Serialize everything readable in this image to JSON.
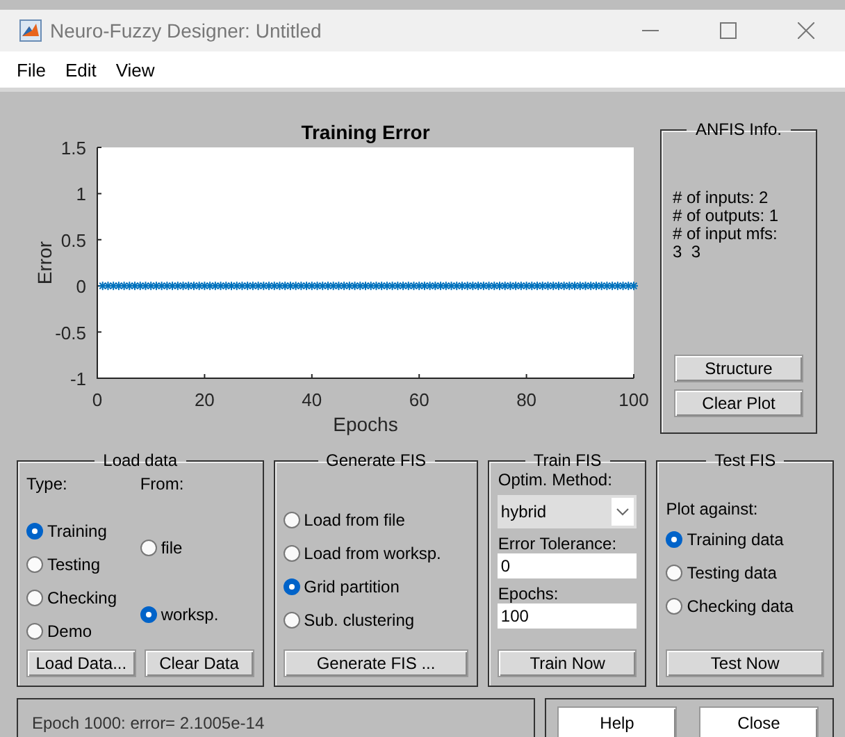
{
  "window": {
    "title": "Neuro-Fuzzy Designer: Untitled"
  },
  "menu": [
    "File",
    "Edit",
    "View"
  ],
  "plot": {
    "chart_data": {
      "type": "scatter",
      "title": "Training Error",
      "xlabel": "Epochs",
      "ylabel": "Error",
      "x": [
        1,
        2,
        3,
        4,
        5,
        6,
        7,
        8,
        9,
        10,
        11,
        12,
        13,
        14,
        15,
        16,
        17,
        18,
        19,
        20,
        21,
        22,
        23,
        24,
        25,
        26,
        27,
        28,
        29,
        30,
        31,
        32,
        33,
        34,
        35,
        36,
        37,
        38,
        39,
        40,
        41,
        42,
        43,
        44,
        45,
        46,
        47,
        48,
        49,
        50,
        51,
        52,
        53,
        54,
        55,
        56,
        57,
        58,
        59,
        60,
        61,
        62,
        63,
        64,
        65,
        66,
        67,
        68,
        69,
        70,
        71,
        72,
        73,
        74,
        75,
        76,
        77,
        78,
        79,
        80,
        81,
        82,
        83,
        84,
        85,
        86,
        87,
        88,
        89,
        90,
        91,
        92,
        93,
        94,
        95,
        96,
        97,
        98,
        99,
        100
      ],
      "series": [
        {
          "color": "#0072bd",
          "values": [
            0,
            0,
            0,
            0,
            0,
            0,
            0,
            0,
            0,
            0,
            0,
            0,
            0,
            0,
            0,
            0,
            0,
            0,
            0,
            0,
            0,
            0,
            0,
            0,
            0,
            0,
            0,
            0,
            0,
            0,
            0,
            0,
            0,
            0,
            0,
            0,
            0,
            0,
            0,
            0,
            0,
            0,
            0,
            0,
            0,
            0,
            0,
            0,
            0,
            0,
            0,
            0,
            0,
            0,
            0,
            0,
            0,
            0,
            0,
            0,
            0,
            0,
            0,
            0,
            0,
            0,
            0,
            0,
            0,
            0,
            0,
            0,
            0,
            0,
            0,
            0,
            0,
            0,
            0,
            0,
            0,
            0,
            0,
            0,
            0,
            0,
            0,
            0,
            0,
            0,
            0,
            0,
            0,
            0,
            0,
            0,
            0,
            0,
            0,
            0
          ]
        }
      ],
      "xlim": [
        0,
        100
      ],
      "ylim": [
        -1,
        1.5
      ],
      "xticks": [
        0,
        20,
        40,
        60,
        80,
        100
      ],
      "yticks": [
        -1,
        -0.5,
        0,
        0.5,
        1,
        1.5
      ]
    }
  },
  "anfis_info": {
    "title": "ANFIS Info.",
    "lines": [
      "# of inputs: 2",
      "# of outputs: 1",
      "# of input mfs:",
      "3  3"
    ],
    "buttons": [
      "Structure",
      "Clear Plot"
    ]
  },
  "load_data": {
    "title": "Load data",
    "type_label": "Type:",
    "from_label": "From:",
    "type_options": [
      {
        "label": "Training",
        "selected": true
      },
      {
        "label": "Testing",
        "selected": false
      },
      {
        "label": "Checking",
        "selected": false
      },
      {
        "label": "Demo",
        "selected": false
      }
    ],
    "from_options": [
      {
        "label": "file",
        "selected": false
      },
      {
        "label": "worksp.",
        "selected": true
      }
    ],
    "buttons": [
      "Load Data...",
      "Clear Data"
    ]
  },
  "generate_fis": {
    "title": "Generate FIS",
    "options": [
      {
        "label": "Load from file",
        "selected": false
      },
      {
        "label": "Load from worksp.",
        "selected": false
      },
      {
        "label": "Grid partition",
        "selected": true
      },
      {
        "label": "Sub. clustering",
        "selected": false
      }
    ],
    "button": "Generate FIS ..."
  },
  "train_fis": {
    "title": "Train FIS",
    "method_label": "Optim. Method:",
    "method": "hybrid",
    "tolerance_label": "Error Tolerance:",
    "tolerance": "0",
    "epochs_label": "Epochs:",
    "epochs": "100",
    "button": "Train Now"
  },
  "test_fis": {
    "title": "Test FIS",
    "plot_against_label": "Plot against:",
    "options": [
      {
        "label": "Training data",
        "selected": true
      },
      {
        "label": "Testing data",
        "selected": false
      },
      {
        "label": "Checking data",
        "selected": false
      }
    ],
    "button": "Test Now"
  },
  "status": "Epoch 1000: error= 2.1005e-14",
  "buttons": [
    "Help",
    "Close"
  ]
}
